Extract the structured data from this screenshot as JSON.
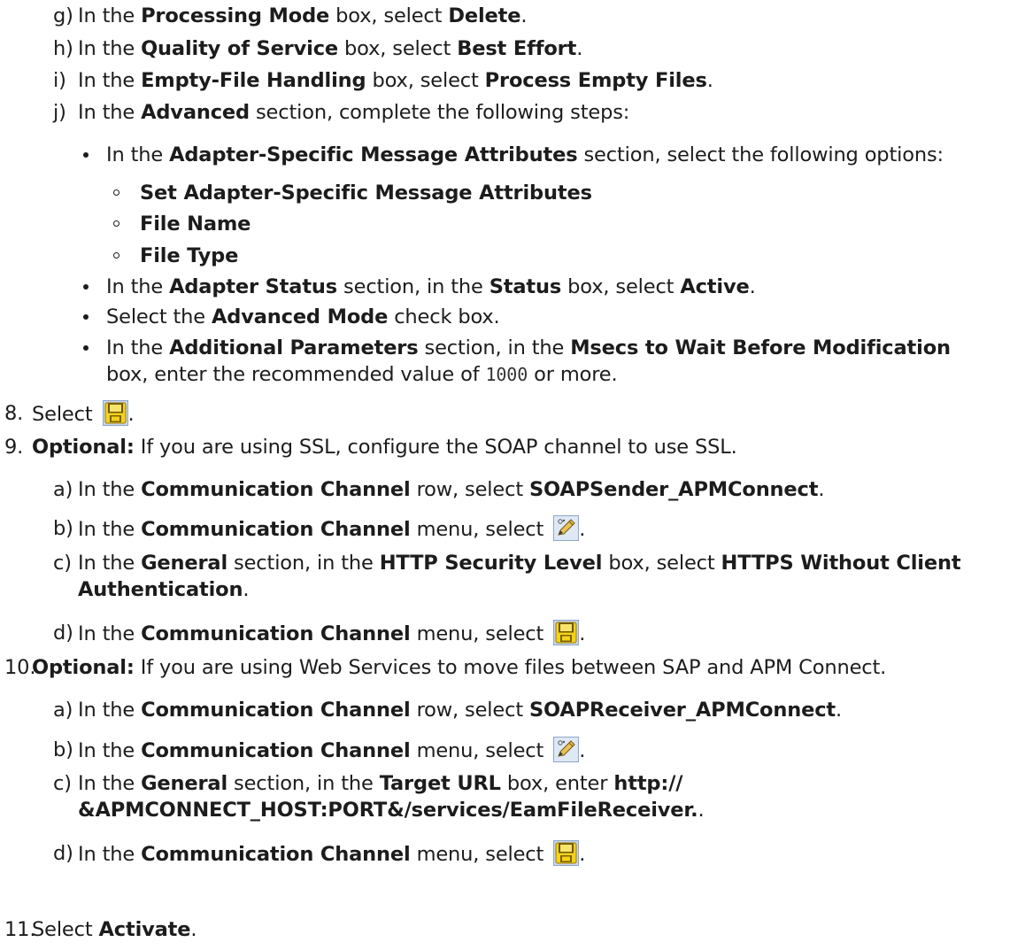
{
  "step7": {
    "g": {
      "marker": "g)",
      "t1": "In the ",
      "b1": "Processing Mode",
      "t2": " box, select ",
      "b2": "Delete",
      "t3": "."
    },
    "h": {
      "marker": "h)",
      "t1": "In the ",
      "b1": "Quality of Service",
      "t2": " box, select ",
      "b2": "Best Effort",
      "t3": "."
    },
    "i": {
      "marker": "i)",
      "t1": "In the ",
      "b1": "Empty-File Handling",
      "t2": " box, select ",
      "b2": "Process Empty Files",
      "t3": "."
    },
    "j": {
      "marker": "j)",
      "t1": "In the ",
      "b1": "Advanced",
      "t2": " section, complete the following steps:"
    },
    "bullets": {
      "b1": {
        "t1": "In the ",
        "b1": "Adapter-Specific Message Attributes",
        "t2": " section, select the following options:"
      },
      "sub": [
        "Set Adapter-Specific Message Attributes",
        "File Name",
        "File Type"
      ],
      "b2": {
        "t1": "In the ",
        "b1": "Adapter Status",
        "t2": " section, in the ",
        "b2": "Status",
        "t3": " box, select ",
        "b3": "Active",
        "t4": "."
      },
      "b3": {
        "t1": "Select the ",
        "b1": "Advanced Mode",
        "t2": " check box."
      },
      "b4": {
        "t1": "In the ",
        "b1": "Additional Parameters",
        "t2": " section, in the ",
        "b2": "Msecs to Wait Before Modification"
      },
      "b4cont": {
        "t1": "box, enter the recommended value of ",
        "code": "1000",
        "t2": " or more."
      }
    }
  },
  "step8": {
    "num": "8.",
    "text": "Select ",
    "icon": "save-icon",
    "end": "."
  },
  "step9": {
    "num": "9.",
    "b1": "Optional:",
    "t1": " If you are using SSL, configure the SOAP channel to use SSL.",
    "a": {
      "marker": "a)",
      "t1": "In the ",
      "b1": "Communication Channel",
      "t2": " row, select ",
      "b2": "SOAPSender_APMConnect",
      "t3": "."
    },
    "b": {
      "marker": "b)",
      "t1": "In the ",
      "b1": "Communication Channel",
      "t2": " menu, select ",
      "icon": "edit-icon",
      "t3": "."
    },
    "c": {
      "marker": "c)",
      "t1": "In the ",
      "b1": "General",
      "t2": " section, in the ",
      "b2": "HTTP Security Level",
      "t3": " box, select ",
      "b3": "HTTPS Without Client"
    },
    "c2": {
      "b1": "Authentication",
      "t1": "."
    },
    "d": {
      "marker": "d)",
      "t1": "In the ",
      "b1": "Communication Channel",
      "t2": " menu, select ",
      "icon": "save-icon",
      "t3": "."
    }
  },
  "step10": {
    "num": "10.",
    "b1": "Optional:",
    "t1": " If you are using Web Services to move files between SAP and APM Connect.",
    "a": {
      "marker": "a)",
      "t1": "In the ",
      "b1": "Communication Channel",
      "t2": " row, select ",
      "b2": "SOAPReceiver_APMConnect",
      "t3": "."
    },
    "b": {
      "marker": "b)",
      "t1": "In the ",
      "b1": "Communication Channel",
      "t2": " menu, select ",
      "icon": "edit-icon",
      "t3": "."
    },
    "c": {
      "marker": "c)",
      "t1": "In the ",
      "b1": "General",
      "t2": " section, in the ",
      "b2": "Target URL",
      "t3": " box, enter ",
      "b3": "http://"
    },
    "c2": {
      "b1": "&APMCONNECT_HOST:PORT&/services/EamFileReceiver.",
      "t1": "."
    },
    "d": {
      "marker": "d)",
      "t1": "In the ",
      "b1": "Communication Channel",
      "t2": " menu, select ",
      "icon": "save-icon",
      "t3": "."
    }
  },
  "step11": {
    "num": "11.",
    "text": "Select ",
    "b1": "Activate",
    "end": "."
  }
}
